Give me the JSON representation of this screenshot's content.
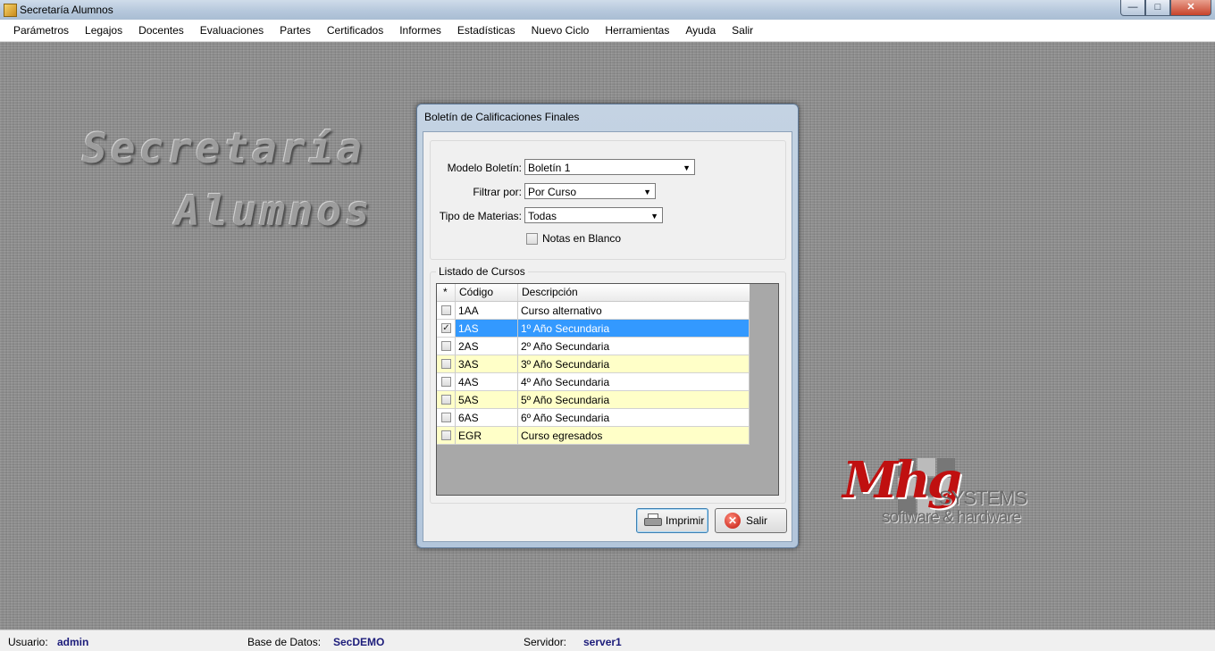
{
  "window": {
    "title": "Secretaría Alumnos",
    "minimize": "—",
    "maximize": "□",
    "close": "✕"
  },
  "menu": [
    "Parámetros",
    "Legajos",
    "Docentes",
    "Evaluaciones",
    "Partes",
    "Certificados",
    "Informes",
    "Estadísticas",
    "Nuevo Ciclo",
    "Herramientas",
    "Ayuda",
    "Salir"
  ],
  "background": {
    "title_line1": "Secretaría",
    "title_line2": "Alumnos",
    "logo_mark": "Mhg",
    "logo_systems": "SYSTEMS",
    "logo_tagline": "software & hardware"
  },
  "dialog": {
    "title": "Boletín de Calificaciones Finales",
    "modelo_label": "Modelo Boletín:",
    "modelo_value": "Boletín 1",
    "filtrar_label": "Filtrar por:",
    "filtrar_value": "Por Curso",
    "tipo_label": "Tipo de Materias:",
    "tipo_value": "Todas",
    "notas_blanco_label": "Notas en Blanco",
    "notas_blanco_checked": false,
    "list_legend": "Listado de Cursos",
    "columns": {
      "check": "*",
      "codigo": "Código",
      "descripcion": "Descripción"
    },
    "rows": [
      {
        "codigo": "1AA",
        "descripcion": "Curso alternativo",
        "checked": false
      },
      {
        "codigo": "1AS",
        "descripcion": "1º Año Secundaria",
        "checked": true
      },
      {
        "codigo": "2AS",
        "descripcion": "2º Año Secundaria",
        "checked": false
      },
      {
        "codigo": "3AS",
        "descripcion": "3º Año Secundaria",
        "checked": false
      },
      {
        "codigo": "4AS",
        "descripcion": "4º Año Secundaria",
        "checked": false
      },
      {
        "codigo": "5AS",
        "descripcion": "5º Año Secundaria",
        "checked": false
      },
      {
        "codigo": "6AS",
        "descripcion": "6º Año Secundaria",
        "checked": false
      },
      {
        "codigo": "EGR",
        "descripcion": "Curso egresados",
        "checked": false
      }
    ],
    "print_button": "Imprimir",
    "exit_button": "Salir"
  },
  "status": {
    "user_label": "Usuario:",
    "user_value": "admin",
    "db_label": "Base de Datos:",
    "db_value": "SecDEMO",
    "server_label": "Servidor:",
    "server_value": "server1"
  },
  "colors": {
    "selection": "#3399ff",
    "alt_row": "#ffffc8",
    "logo_red": "#c01010"
  }
}
